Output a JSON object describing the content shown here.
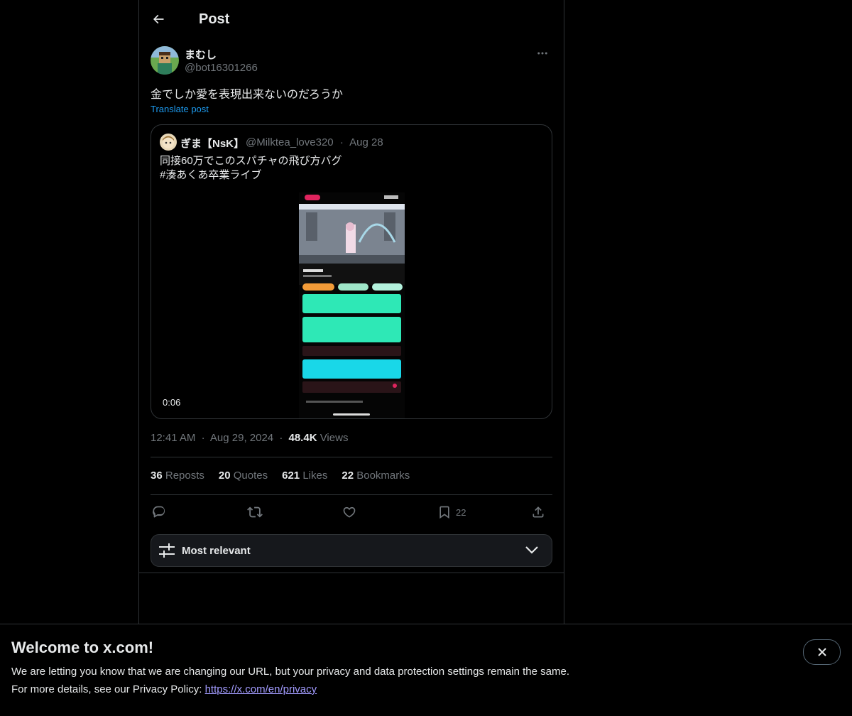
{
  "header": {
    "title": "Post"
  },
  "post": {
    "author_name": "まむし",
    "author_handle": "@bot16301266",
    "text": "金でしか愛を表現出来ないのだろうか",
    "translate_label": "Translate post",
    "time": "12:41 AM",
    "date": "Aug 29, 2024",
    "views_count": "48.4K",
    "views_label": "Views",
    "dot": "·"
  },
  "quote": {
    "author_name": "ぎま【NsK】",
    "author_handle": "@Milktea_love320",
    "date": "Aug 28",
    "text": "同接60万でこのスパチャの飛び方バグ\n #湊あくあ卒業ライブ",
    "video_duration": "0:06"
  },
  "stats": {
    "reposts_count": "36",
    "reposts_label": "Reposts",
    "quotes_count": "20",
    "quotes_label": "Quotes",
    "likes_count": "621",
    "likes_label": "Likes",
    "bookmarks_count": "22",
    "bookmarks_label": "Bookmarks"
  },
  "actions": {
    "icons": [
      "reply-icon",
      "repost-icon",
      "like-icon",
      "bookmark-icon",
      "share-icon"
    ],
    "bookmark_count": "22"
  },
  "sort": {
    "label": "Most relevant"
  },
  "banner": {
    "title": "Welcome to x.com!",
    "line1": "We are letting you know that we are changing our URL, but your privacy and data protection settings remain the same.",
    "line2_prefix": "For more details, see our Privacy Policy: ",
    "link": "https://x.com/en/privacy"
  },
  "colors": {
    "background": "#000000",
    "text": "#e7e9ea",
    "muted": "#71767b",
    "accent": "#1d9bf0",
    "border": "#2f3336"
  }
}
